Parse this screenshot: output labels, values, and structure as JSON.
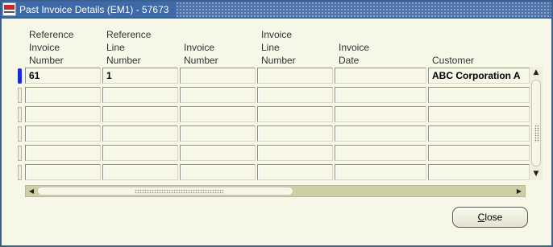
{
  "window": {
    "title": "Past Invoice Details (EM1) - 57673",
    "icon": "oracle-app-icon"
  },
  "columns": [
    "Reference\nInvoice\nNumber",
    "Reference\nLine\nNumber",
    "Invoice\nNumber",
    "Invoice\nLine\nNumber",
    "Invoice\nDate",
    "Customer"
  ],
  "rows": [
    [
      "61",
      "1",
      "",
      "",
      "",
      "ABC Corporation A"
    ],
    [
      "",
      "",
      "",
      "",
      "",
      ""
    ],
    [
      "",
      "",
      "",
      "",
      "",
      ""
    ],
    [
      "",
      "",
      "",
      "",
      "",
      ""
    ],
    [
      "",
      "",
      "",
      "",
      "",
      ""
    ],
    [
      "",
      "",
      "",
      "",
      "",
      ""
    ]
  ],
  "buttons": {
    "close_mnemonic": "C",
    "close_rest": "lose"
  },
  "colors": {
    "title_bar": "#4d72a8",
    "background": "#f7f7e7",
    "row_indicator_active": "#1b2bd9"
  }
}
